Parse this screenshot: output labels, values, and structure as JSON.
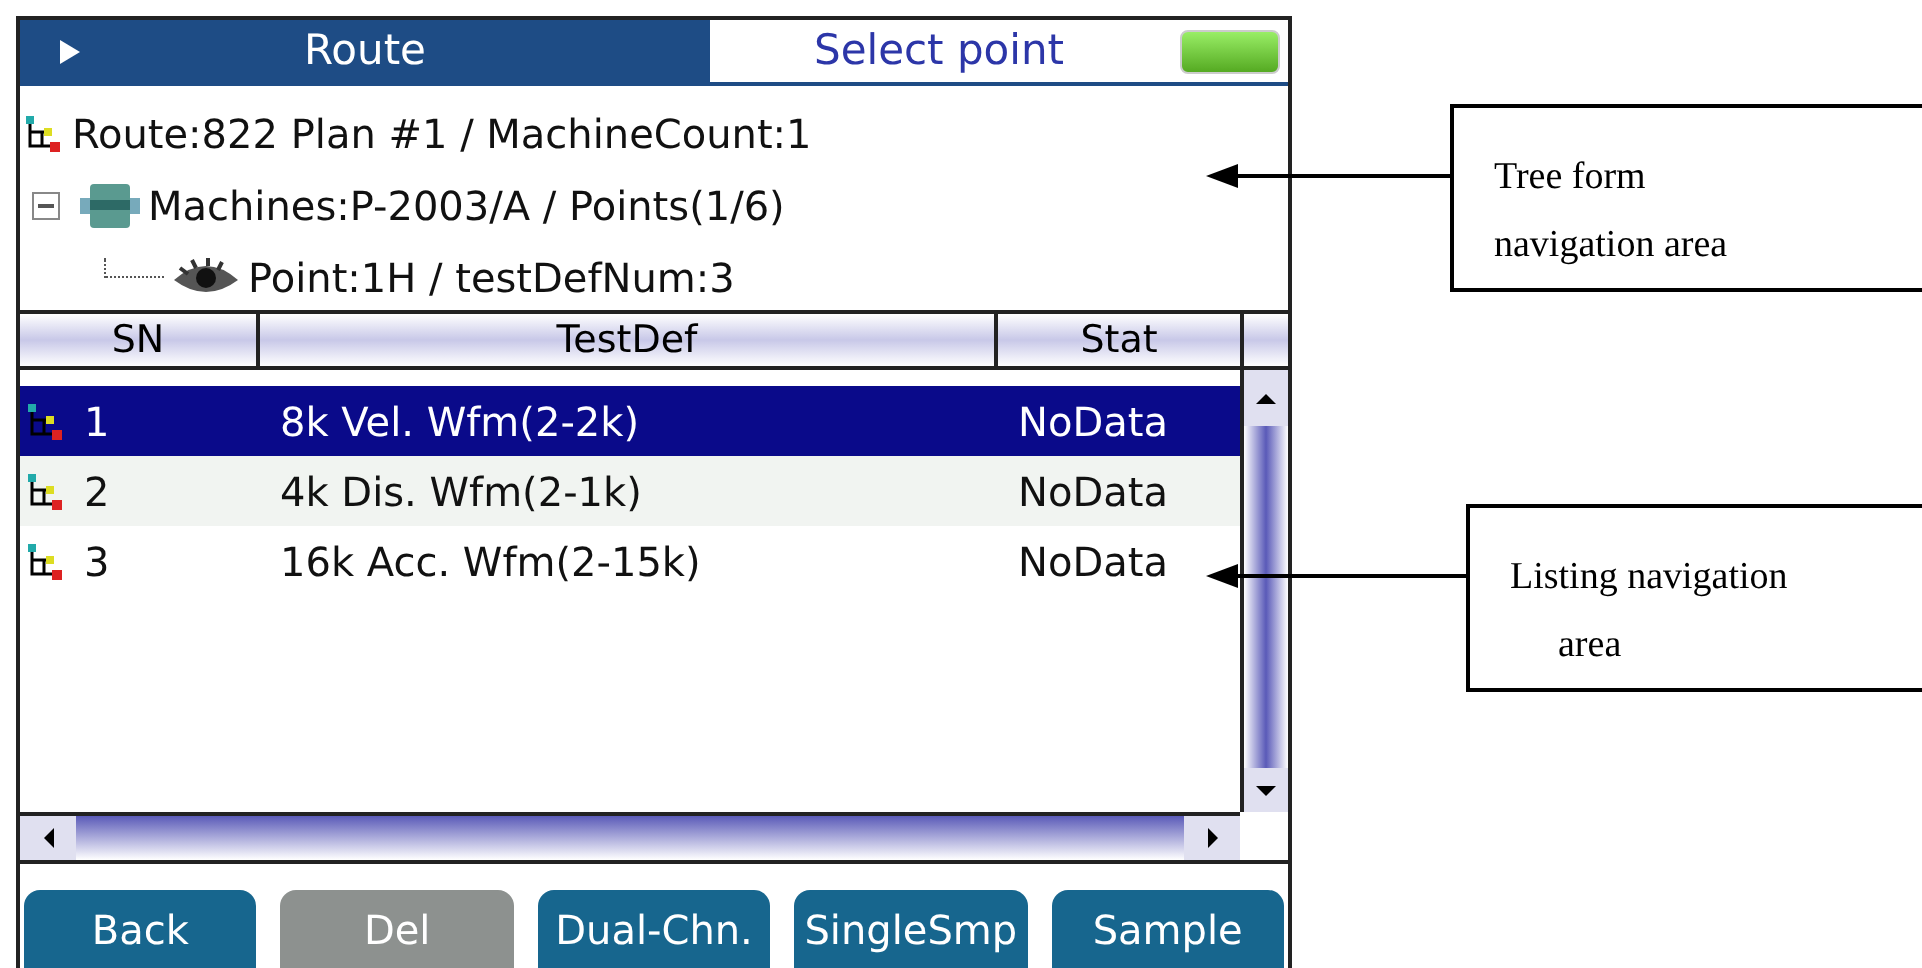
{
  "header": {
    "tabs": [
      {
        "label": "Route",
        "selected": true
      },
      {
        "label": "Select point",
        "selected": false
      }
    ]
  },
  "tree": [
    {
      "label": "Route:822 Plan #1 / MachineCount:1",
      "kind": "route",
      "children": [
        {
          "label": "Machines:P-2003/A / Points(1/6)",
          "kind": "machine",
          "expanded": true,
          "children": [
            {
              "label": "Point:1H / testDefNum:3",
              "kind": "point"
            }
          ]
        }
      ]
    }
  ],
  "table": {
    "columns": [
      "SN",
      "TestDef",
      "Stat"
    ],
    "rows": [
      {
        "sn": "1",
        "testdef": "8k Vel. Wfm(2-2k)",
        "stat": "NoData",
        "selected": true
      },
      {
        "sn": "2",
        "testdef": "4k Dis. Wfm(2-1k)",
        "stat": "NoData",
        "selected": false
      },
      {
        "sn": "3",
        "testdef": "16k Acc. Wfm(2-15k)",
        "stat": "NoData",
        "selected": false
      }
    ]
  },
  "buttons": [
    {
      "label": "Back",
      "disabled": false
    },
    {
      "label": "Del",
      "disabled": true
    },
    {
      "label": "Dual-Chn.",
      "disabled": false
    },
    {
      "label": "SingleSmp",
      "disabled": false
    },
    {
      "label": "Sample",
      "disabled": false
    }
  ],
  "callouts": [
    {
      "lines": [
        "Tree form",
        "navigation area"
      ]
    },
    {
      "lines": [
        "Listing navigation",
        "area"
      ]
    }
  ]
}
